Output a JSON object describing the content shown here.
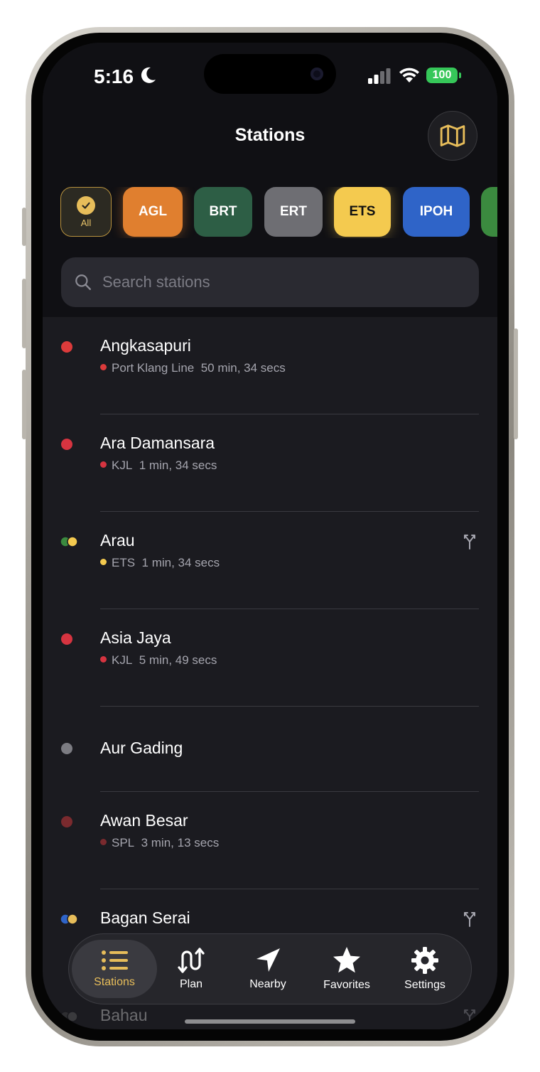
{
  "status_bar": {
    "time": "5:16",
    "battery": "100"
  },
  "header": {
    "title": "Stations"
  },
  "filters": [
    {
      "label": "All",
      "bg": "#2c2a22",
      "fg": "#e9c46a",
      "selected": true
    },
    {
      "label": "AGL",
      "bg": "#e07f2f",
      "fg": "#ffffff"
    },
    {
      "label": "BRT",
      "bg": "#2d5e45",
      "fg": "#ffffff"
    },
    {
      "label": "ERT",
      "bg": "#6e6e73",
      "fg": "#ffffff"
    },
    {
      "label": "ETS",
      "bg": "#f4ca4f",
      "fg": "#111111"
    },
    {
      "label": "IPOH",
      "bg": "#2f64c8",
      "fg": "#ffffff"
    },
    {
      "label": "",
      "bg": "#3b8a3f",
      "fg": "#ffffff"
    }
  ],
  "search": {
    "placeholder": "Search stations"
  },
  "stations": [
    {
      "name": "Angkasapuri",
      "line": "Port Klang Line",
      "time": "50 min, 34 secs",
      "color": "#dc3b3b"
    },
    {
      "name": "Ara Damansara",
      "line": "KJL",
      "time": "1 min, 34 secs",
      "color": "#d63440"
    },
    {
      "name": "Arau",
      "line": "ETS",
      "time": "1 min, 34 secs",
      "color": "#f4ca4f",
      "colors": [
        "#3b8a3f",
        "#f4ca4f"
      ],
      "interchange": true
    },
    {
      "name": "Asia Jaya",
      "line": "KJL",
      "time": "5 min, 49 secs",
      "color": "#d63440"
    },
    {
      "name": "Aur Gading",
      "line": "",
      "time": "",
      "color": "#7c7c82"
    },
    {
      "name": "Awan Besar",
      "line": "SPL",
      "time": "3 min, 13 secs",
      "color": "#7a2a2e"
    },
    {
      "name": "Bagan Serai",
      "line": "",
      "time": "",
      "color": "#f4ca4f",
      "colors": [
        "#2f64c8",
        "#e7bd5a"
      ],
      "interchange": true
    },
    {
      "name": "Bahau",
      "line": "",
      "time": "",
      "color": "#7c7c82",
      "colors": [
        "#555555",
        "#777777"
      ],
      "interchange": true
    }
  ],
  "tabbar": {
    "stations": "Stations",
    "plan": "Plan",
    "nearby": "Nearby",
    "favorites": "Favorites",
    "settings": "Settings"
  },
  "colors": {
    "accent": "#e7bd5a",
    "background": "#1b1b20"
  }
}
